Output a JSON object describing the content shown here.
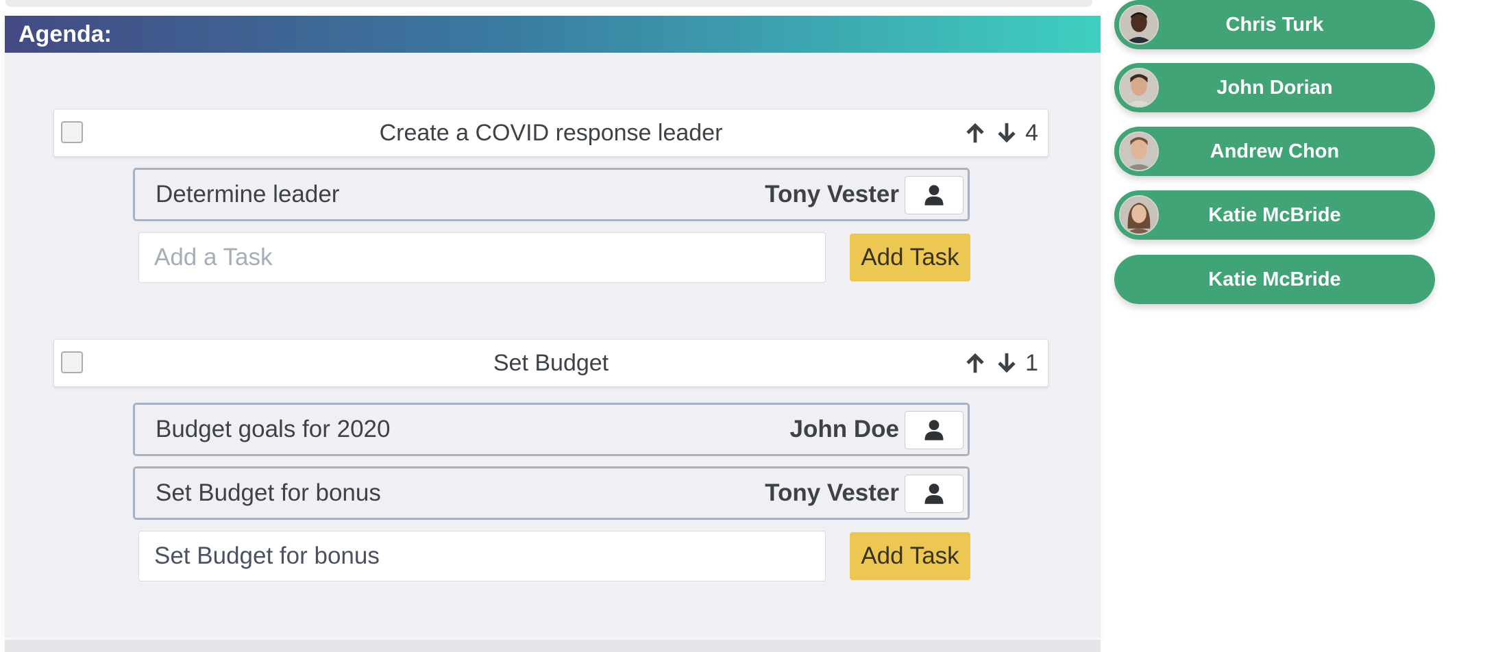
{
  "agenda": {
    "title": "Agenda:",
    "items": [
      {
        "title": "Create a COVID response leader",
        "priority": "4",
        "tasks": [
          {
            "label": "Determine leader",
            "assignee": "Tony Vester"
          }
        ],
        "new_task": {
          "value": "",
          "placeholder": "Add a Task",
          "button": "Add Task"
        }
      },
      {
        "title": "Set Budget",
        "priority": "1",
        "tasks": [
          {
            "label": "Budget goals for 2020",
            "assignee": "John Doe"
          },
          {
            "label": "Set Budget for bonus",
            "assignee": "Tony Vester"
          }
        ],
        "new_task": {
          "value": "Set Budget for bonus",
          "placeholder": "Add a Task",
          "button": "Add Task"
        }
      }
    ]
  },
  "attendees": [
    {
      "name": "Chris Turk",
      "has_avatar": true
    },
    {
      "name": "John Dorian",
      "has_avatar": true
    },
    {
      "name": "Andrew Chon",
      "has_avatar": true
    },
    {
      "name": "Katie McBride",
      "has_avatar": true
    },
    {
      "name": "Katie McBride",
      "has_avatar": false
    }
  ],
  "icons": {
    "move_up": "arrow-up-icon",
    "move_down": "arrow-down-icon",
    "assign": "user-icon"
  },
  "colors": {
    "header_gradient_start": "#444a83",
    "header_gradient_end": "#3fcfc0",
    "attendee_pill": "#40a477",
    "add_task_button": "#ecc853",
    "task_border": "#a7b1c2"
  }
}
